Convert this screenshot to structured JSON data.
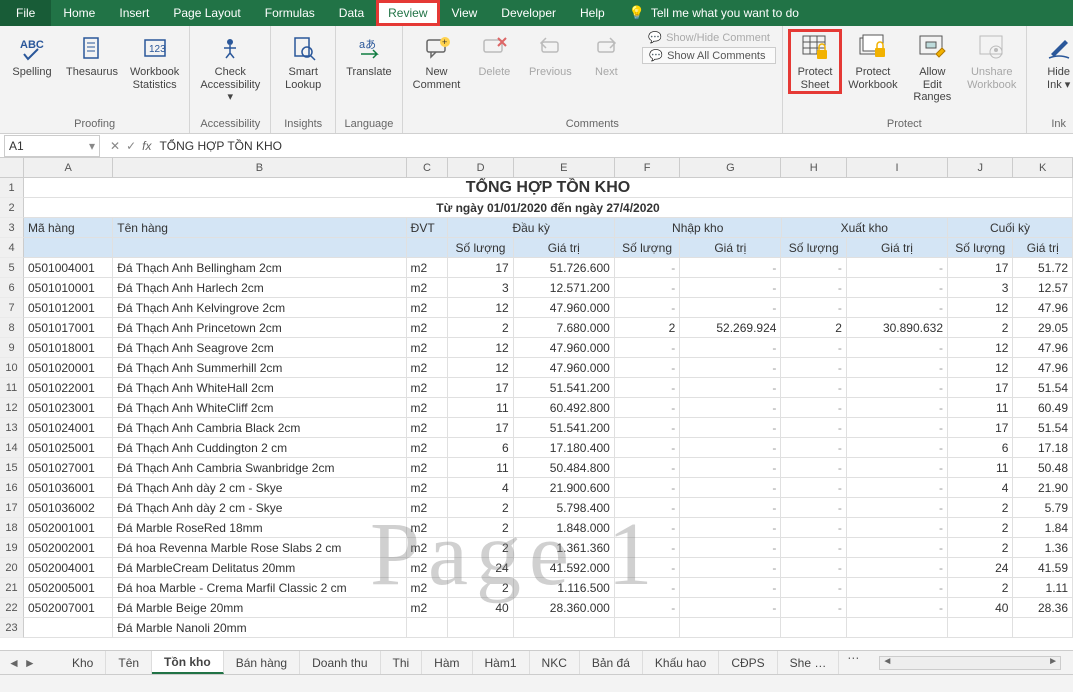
{
  "tabs": {
    "file": "File",
    "home": "Home",
    "insert": "Insert",
    "pagelayout": "Page Layout",
    "formulas": "Formulas",
    "data": "Data",
    "review": "Review",
    "view": "View",
    "developer": "Developer",
    "help": "Help",
    "tell": "Tell me what you want to do"
  },
  "ribbon": {
    "proofing": {
      "label": "Proofing",
      "spelling": "Spelling",
      "thesaurus": "Thesaurus",
      "stats": "Workbook\nStatistics"
    },
    "accessibility": {
      "label": "Accessibility",
      "check": "Check\nAccessibility ▾"
    },
    "insights": {
      "label": "Insights",
      "smart": "Smart\nLookup"
    },
    "language": {
      "label": "Language",
      "translate": "Translate"
    },
    "comments": {
      "label": "Comments",
      "new": "New\nComment",
      "delete": "Delete",
      "prev": "Previous",
      "next": "Next",
      "showhide": "Show/Hide Comment",
      "showall": "Show All Comments"
    },
    "protect": {
      "label": "Protect",
      "sheet": "Protect\nSheet",
      "workbook": "Protect\nWorkbook",
      "ranges": "Allow Edit\nRanges",
      "unshare": "Unshare\nWorkbook"
    },
    "ink": {
      "label": "Ink",
      "hide": "Hide\nInk ▾"
    }
  },
  "formula_bar": {
    "cell": "A1",
    "value": "TỔNG HỢP TỒN KHO"
  },
  "columns": [
    "A",
    "B",
    "C",
    "D",
    "E",
    "F",
    "G",
    "H",
    "I",
    "J",
    "K"
  ],
  "title": "TỔNG HỢP TỒN KHO",
  "subtitle": "Từ ngày 01/01/2020 đến ngày 27/4/2020",
  "headers": {
    "ma": "Mã hàng",
    "ten": "Tên hàng",
    "dvt": "ĐVT",
    "dauky": "Đầu kỳ",
    "nhap": "Nhập kho",
    "xuat": "Xuất kho",
    "cuoi": "Cuối kỳ",
    "sl": "Số lượng",
    "gt": "Giá trị"
  },
  "rows": [
    {
      "n": 5,
      "ma": "0501004001",
      "ten": "Đá Thạch Anh Bellingham 2cm",
      "dvt": "m2",
      "dksl": "17",
      "dkgt": "51.726.600",
      "nsl": "-",
      "ngt": "-",
      "xsl": "-",
      "xgt": "-",
      "csl": "17",
      "cgt": "51.72"
    },
    {
      "n": 6,
      "ma": "0501010001",
      "ten": "Đá Thạch Anh Harlech 2cm",
      "dvt": "m2",
      "dksl": "3",
      "dkgt": "12.571.200",
      "nsl": "-",
      "ngt": "-",
      "xsl": "-",
      "xgt": "-",
      "csl": "3",
      "cgt": "12.57"
    },
    {
      "n": 7,
      "ma": "0501012001",
      "ten": "Đá Thạch Anh Kelvingrove 2cm",
      "dvt": "m2",
      "dksl": "12",
      "dkgt": "47.960.000",
      "nsl": "-",
      "ngt": "-",
      "xsl": "-",
      "xgt": "-",
      "csl": "12",
      "cgt": "47.96"
    },
    {
      "n": 8,
      "ma": "0501017001",
      "ten": "Đá Thạch Anh Princetown 2cm",
      "dvt": "m2",
      "dksl": "2",
      "dkgt": "7.680.000",
      "nsl": "2",
      "ngt": "52.269.924",
      "xsl": "2",
      "xgt": "30.890.632",
      "csl": "2",
      "cgt": "29.05"
    },
    {
      "n": 9,
      "ma": "0501018001",
      "ten": "Đá Thạch Anh Seagrove 2cm",
      "dvt": "m2",
      "dksl": "12",
      "dkgt": "47.960.000",
      "nsl": "-",
      "ngt": "-",
      "xsl": "-",
      "xgt": "-",
      "csl": "12",
      "cgt": "47.96"
    },
    {
      "n": 10,
      "ma": "0501020001",
      "ten": "Đá Thạch Anh Summerhill 2cm",
      "dvt": "m2",
      "dksl": "12",
      "dkgt": "47.960.000",
      "nsl": "-",
      "ngt": "-",
      "xsl": "-",
      "xgt": "-",
      "csl": "12",
      "cgt": "47.96"
    },
    {
      "n": 11,
      "ma": "0501022001",
      "ten": "Đá Thạch Anh WhiteHall 2cm",
      "dvt": "m2",
      "dksl": "17",
      "dkgt": "51.541.200",
      "nsl": "-",
      "ngt": "-",
      "xsl": "-",
      "xgt": "-",
      "csl": "17",
      "cgt": "51.54"
    },
    {
      "n": 12,
      "ma": "0501023001",
      "ten": "Đá Thạch Anh WhiteCliff 2cm",
      "dvt": "m2",
      "dksl": "11",
      "dkgt": "60.492.800",
      "nsl": "-",
      "ngt": "-",
      "xsl": "-",
      "xgt": "-",
      "csl": "11",
      "cgt": "60.49"
    },
    {
      "n": 13,
      "ma": "0501024001",
      "ten": "Đá Thạch Anh Cambria Black 2cm",
      "dvt": "m2",
      "dksl": "17",
      "dkgt": "51.541.200",
      "nsl": "-",
      "ngt": "-",
      "xsl": "-",
      "xgt": "-",
      "csl": "17",
      "cgt": "51.54"
    },
    {
      "n": 14,
      "ma": "0501025001",
      "ten": "Đá Thạch Anh Cuddington 2 cm",
      "dvt": "m2",
      "dksl": "6",
      "dkgt": "17.180.400",
      "nsl": "-",
      "ngt": "-",
      "xsl": "-",
      "xgt": "-",
      "csl": "6",
      "cgt": "17.18"
    },
    {
      "n": 15,
      "ma": "0501027001",
      "ten": "Đá Thạch Anh Cambria Swanbridge 2cm",
      "dvt": "m2",
      "dksl": "11",
      "dkgt": "50.484.800",
      "nsl": "-",
      "ngt": "-",
      "xsl": "-",
      "xgt": "-",
      "csl": "11",
      "cgt": "50.48"
    },
    {
      "n": 16,
      "ma": "0501036001",
      "ten": "Đá Thạch Anh dày 2 cm - Skye",
      "dvt": "m2",
      "dksl": "4",
      "dkgt": "21.900.600",
      "nsl": "-",
      "ngt": "-",
      "xsl": "-",
      "xgt": "-",
      "csl": "4",
      "cgt": "21.90"
    },
    {
      "n": 17,
      "ma": "0501036002",
      "ten": "Đá Thạch Anh dày 2 cm - Skye",
      "dvt": "m2",
      "dksl": "2",
      "dkgt": "5.798.400",
      "nsl": "-",
      "ngt": "-",
      "xsl": "-",
      "xgt": "-",
      "csl": "2",
      "cgt": "5.79"
    },
    {
      "n": 18,
      "ma": "0502001001",
      "ten": "Đá Marble RoseRed 18mm",
      "dvt": "m2",
      "dksl": "2",
      "dkgt": "1.848.000",
      "nsl": "-",
      "ngt": "-",
      "xsl": "-",
      "xgt": "-",
      "csl": "2",
      "cgt": "1.84"
    },
    {
      "n": 19,
      "ma": "0502002001",
      "ten": "Đá hoa Revenna Marble Rose Slabs 2 cm",
      "dvt": "m2",
      "dksl": "2",
      "dkgt": "1.361.360",
      "nsl": "-",
      "ngt": "-",
      "xsl": "-",
      "xgt": "-",
      "csl": "2",
      "cgt": "1.36"
    },
    {
      "n": 20,
      "ma": "0502004001",
      "ten": "Đá MarbleCream Delitatus 20mm",
      "dvt": "m2",
      "dksl": "24",
      "dkgt": "41.592.000",
      "nsl": "-",
      "ngt": "-",
      "xsl": "-",
      "xgt": "-",
      "csl": "24",
      "cgt": "41.59"
    },
    {
      "n": 21,
      "ma": "0502005001",
      "ten": "Đá hoa Marble - Crema Marfil Classic 2 cm",
      "dvt": "m2",
      "dksl": "2",
      "dkgt": "1.116.500",
      "nsl": "-",
      "ngt": "-",
      "xsl": "-",
      "xgt": "-",
      "csl": "2",
      "cgt": "1.11"
    },
    {
      "n": 22,
      "ma": "0502007001",
      "ten": "Đá Marble Beige 20mm",
      "dvt": "m2",
      "dksl": "40",
      "dkgt": "28.360.000",
      "nsl": "-",
      "ngt": "-",
      "xsl": "-",
      "xgt": "-",
      "csl": "40",
      "cgt": "28.36"
    },
    {
      "n": 23,
      "ma": "",
      "ten": "Đá Marble Nanoli 20mm",
      "dvt": "",
      "dksl": "",
      "dkgt": "",
      "nsl": "",
      "ngt": "",
      "xsl": "",
      "xgt": "",
      "csl": "",
      "cgt": ""
    }
  ],
  "row_headers": [
    1,
    2,
    3,
    4,
    5,
    6,
    7,
    8,
    9,
    10,
    11,
    12,
    13,
    14,
    15,
    16,
    17,
    18,
    19,
    20,
    21,
    22,
    23
  ],
  "watermark": "Page 1",
  "sheets": {
    "kho": "Kho",
    "ten": "Tên",
    "tonkho": "Tồn kho",
    "banhang": "Bán hàng",
    "doanhthu": "Doanh thu",
    "thi": "Thi",
    "ham": "Hàm",
    "ham1": "Hàm1",
    "nkc": "NKC",
    "banda": "Bản đá",
    "khauhao": "Khấu hao",
    "cdps": "CĐPS",
    "more": "She …"
  }
}
